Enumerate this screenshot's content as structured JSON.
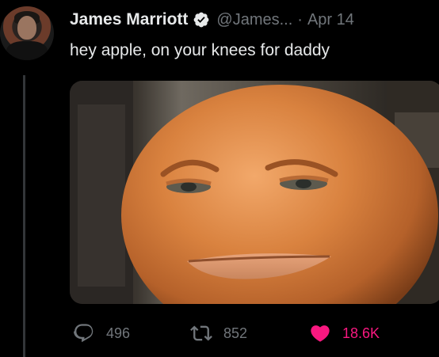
{
  "tweet": {
    "author_name": "James Marriott",
    "handle": "@James...",
    "separator": "·",
    "date": "Apr 14",
    "text": "hey apple, on your knees for daddy"
  },
  "actions": {
    "replies": "496",
    "retweets": "852",
    "likes": "18.6K"
  },
  "icons": {
    "verified": "verified-badge-icon",
    "reply": "reply-icon",
    "retweet": "retweet-icon",
    "like": "heart-icon"
  },
  "colors": {
    "background": "#000000",
    "text": "#e7e9ea",
    "muted": "#71767b",
    "like": "#f91880",
    "verified": "#e7e9ea"
  }
}
